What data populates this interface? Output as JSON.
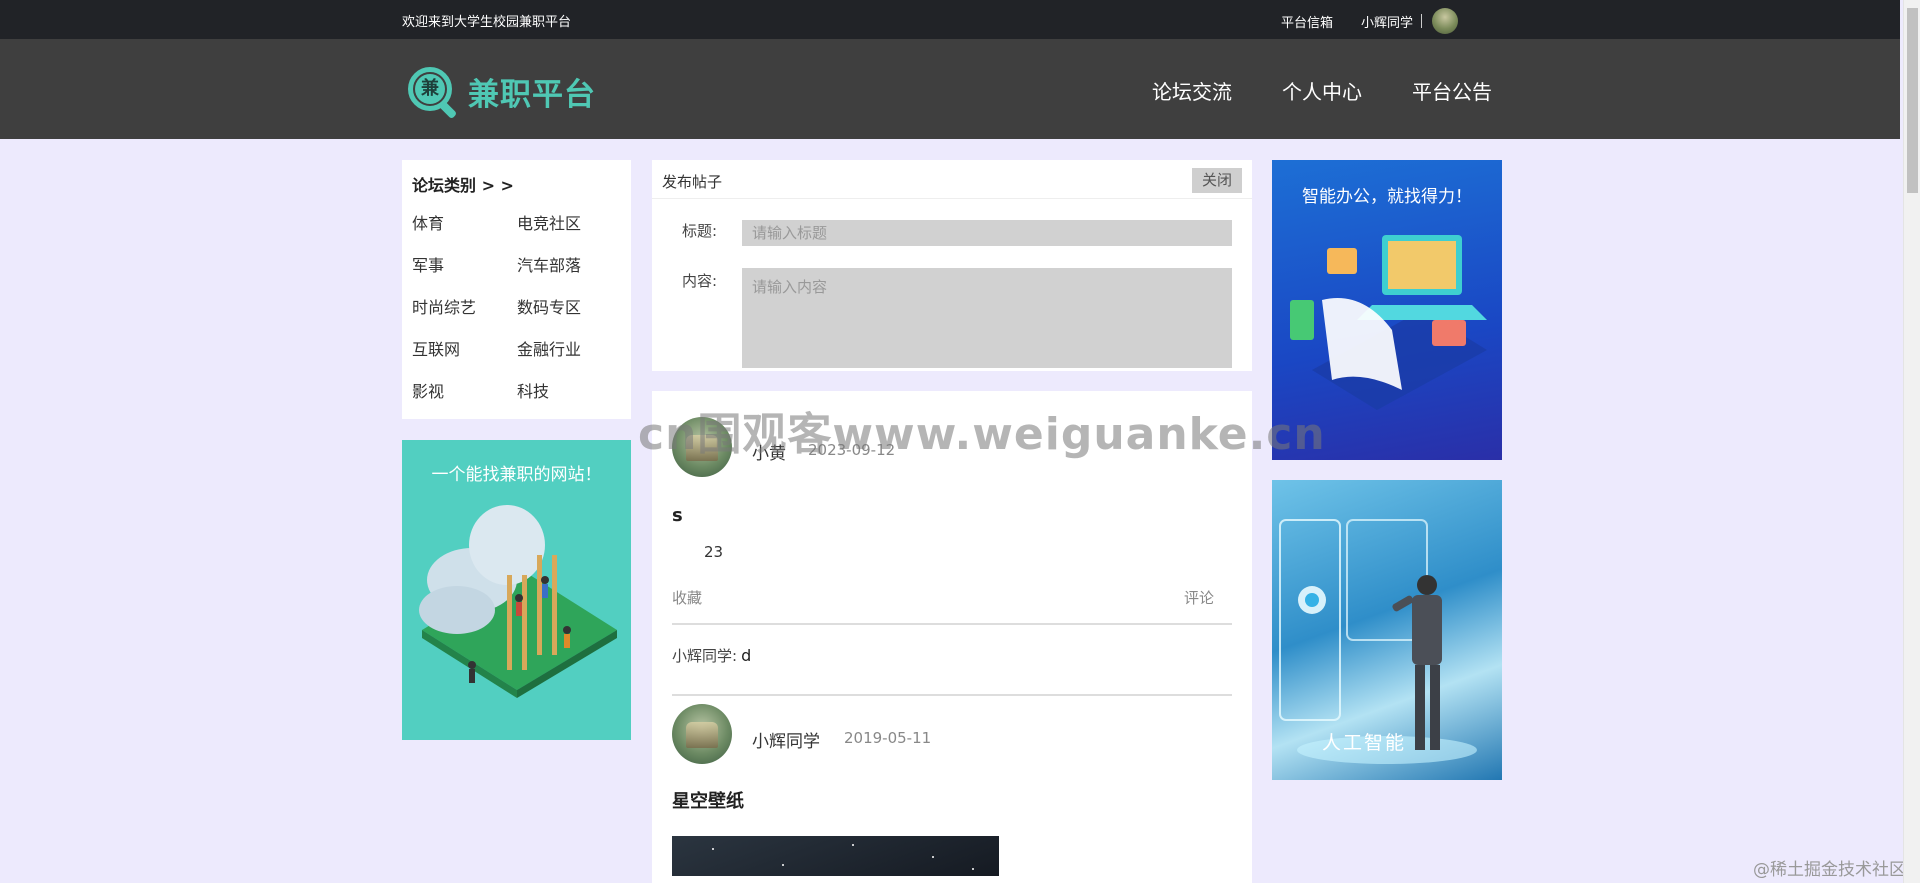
{
  "topbar": {
    "welcome": "欢迎来到大学生校园兼职平台",
    "messages_link": "平台信箱",
    "user_name": "小辉同学"
  },
  "header": {
    "logo_glyph": "兼",
    "logo_text": "兼职平台",
    "nav": [
      "论坛交流",
      "个人中心",
      "平台公告"
    ]
  },
  "categories": {
    "title": "论坛类别 > >",
    "items": [
      "体育",
      "电竞社区",
      "军事",
      "汽车部落",
      "时尚综艺",
      "数码专区",
      "互联网",
      "金融行业",
      "影视",
      "科技"
    ]
  },
  "ads": {
    "left_text": "一个能找兼职的网站！",
    "right_top_text": "智能办公，就找得力！",
    "right_bottom_text": "人工智能"
  },
  "post_form": {
    "header": "发布帖子",
    "close_label": "关闭",
    "title_label": "标题:",
    "title_placeholder": "请输入标题",
    "content_label": "内容:",
    "content_placeholder": "请输入内容"
  },
  "posts": [
    {
      "author": "小黄",
      "date": "2023-09-12",
      "title": "s",
      "body": "23",
      "fav_label": "收藏",
      "comment_label": "评论",
      "comment_author": "小辉同学:",
      "comment_text": "d"
    },
    {
      "author": "小辉同学",
      "date": "2019-05-11",
      "title": "星空壁纸"
    }
  ],
  "watermark": "cn围观客www.weiguanke.cn",
  "footer_watermark": "@稀土掘金技术社区",
  "colors": {
    "accent": "#4fc8b4",
    "page_bg": "#edeafd",
    "topbar_bg": "#212327",
    "header_bg": "#3f3f3f"
  }
}
